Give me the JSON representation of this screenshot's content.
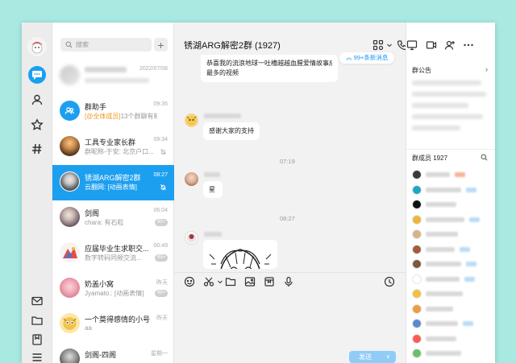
{
  "window": {
    "controls": {
      "minimize": "—",
      "maximize": "□",
      "close": "✕"
    }
  },
  "sidebar": {
    "icons": [
      "message-icon",
      "contacts-icon",
      "star-icon",
      "hashtag-icon",
      "mail-icon",
      "folder-icon",
      "bookmark-icon",
      "menu-icon"
    ]
  },
  "search": {
    "placeholder": "搜索",
    "add_label": "+"
  },
  "conversations": [
    {
      "name": "",
      "sub": "",
      "time": "2022/07/08",
      "blurred": true
    },
    {
      "name": "群助手",
      "sub_highlight": "[@全体成员]",
      "sub": "13个群聊有新...",
      "time": "09:35"
    },
    {
      "name": "工具专业家长群",
      "sub": "群昵称-于安: 北京户口...",
      "time": "09:34",
      "muted": true
    },
    {
      "name": "锈湖ARG解密2群",
      "sub": "云翻网: [动画表情]",
      "time": "08:27",
      "muted": true,
      "selected": true
    },
    {
      "name": "剑阁",
      "sub": "chara: 有石粒",
      "time": "06:04",
      "badge": "99+"
    },
    {
      "name": "应届毕业生求职交...",
      "sub": "数字转码同频交流...",
      "time": "00:49",
      "badge": "99+"
    },
    {
      "name": "奶盖小窝",
      "sub": "Jyamato.: [动画表情]",
      "time": "昨天",
      "badge": "99+"
    },
    {
      "name": "一个莫得感情的小号",
      "sub": "aa",
      "time": "昨天"
    },
    {
      "name": "剑阁-四阁",
      "sub": "",
      "time": "星期一"
    }
  ],
  "chat": {
    "title": "锈湖ARG解密2群 (1927)",
    "new_messages": "99+条新消息",
    "messages": [
      {
        "text_line1": "恭喜我的流浪地球一吐槽越越血腥爱情故事成为占随",
        "text_line2": "最多的视频"
      },
      {
        "text": "感谢大家的支持"
      },
      {
        "timestamp": "07:19"
      },
      {
        "text": "星"
      },
      {
        "timestamp": "08:27"
      }
    ],
    "send_label": "发送",
    "send_caret": "∨"
  },
  "right_panel": {
    "announcement_title": "群公告",
    "members_title": "群成员 1927",
    "member_colors": [
      "#3a3a3a",
      "#1ea7c6",
      "#111111",
      "#f0b43c",
      "#d8b28a",
      "#a15d3e",
      "#7a5a3a",
      "#ffffff",
      "#f0c040",
      "#e8a040",
      "#5a8ad0",
      "#fc5a5a",
      "#6bbf6a"
    ]
  },
  "colors": {
    "accent": "#1d9ff0",
    "highlight": "#f0961b",
    "background": "#a8e9e1"
  }
}
